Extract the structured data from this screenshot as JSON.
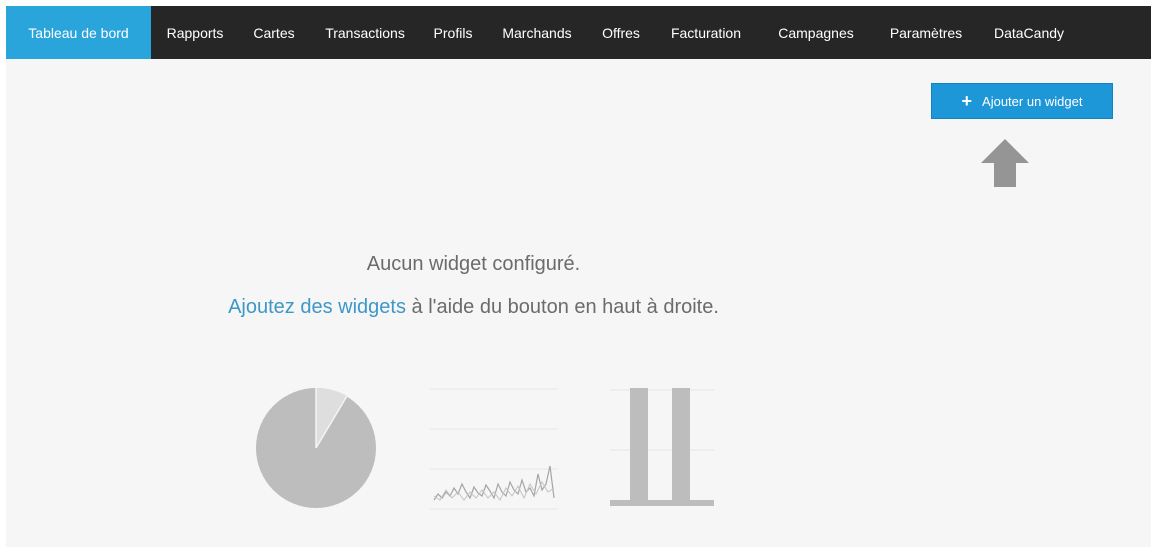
{
  "nav": {
    "items": [
      {
        "label": "Tableau de bord",
        "active": true
      },
      {
        "label": "Rapports",
        "active": false
      },
      {
        "label": "Cartes",
        "active": false
      },
      {
        "label": "Transactions",
        "active": false
      },
      {
        "label": "Profils",
        "active": false
      },
      {
        "label": "Marchands",
        "active": false
      },
      {
        "label": "Offres",
        "active": false
      },
      {
        "label": "Facturation",
        "active": false
      },
      {
        "label": "Campagnes",
        "active": false
      },
      {
        "label": "Paramètres",
        "active": false
      },
      {
        "label": "DataCandy",
        "active": false
      }
    ]
  },
  "toolbar": {
    "add_widget_label": "Ajouter un widget",
    "add_widget_icon": "plus-icon"
  },
  "empty_state": {
    "title": "Aucun widget configuré.",
    "hint_link": "Ajoutez des widgets",
    "hint_rest": " à l'aide du bouton en haut à droite.",
    "pointer_icon": "up-arrow-icon"
  },
  "colors": {
    "nav_bg": "#262626",
    "nav_active": "#2aa5dc",
    "button": "#1e97d8",
    "link": "#3d98c8",
    "illustration": "#bdbdbd"
  }
}
